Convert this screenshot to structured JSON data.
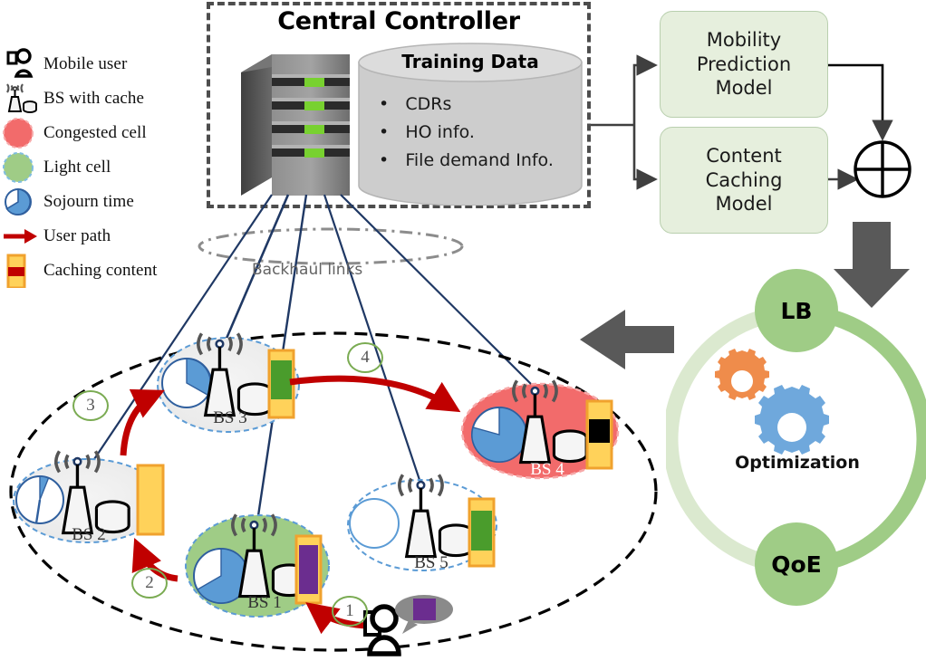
{
  "legend": {
    "items": [
      {
        "icon": "mobile-user-icon",
        "label": "Mobile user"
      },
      {
        "icon": "base-station-cache-icon",
        "label": "BS with cache"
      },
      {
        "icon": "congested-cell-icon",
        "label": "Congested cell"
      },
      {
        "icon": "light-cell-icon",
        "label": "Light cell"
      },
      {
        "icon": "sojourn-time-icon",
        "label": "Sojourn time"
      },
      {
        "icon": "user-path-arrow-icon",
        "label": "User path"
      },
      {
        "icon": "caching-content-icon",
        "label": "Caching content"
      }
    ]
  },
  "controller": {
    "title": "Central Controller",
    "server_icon": "server-rack-icon",
    "database": {
      "title": "Training Data",
      "bullets": [
        "CDRs",
        "HO info.",
        "File demand Info."
      ]
    }
  },
  "models": {
    "mobility": "Mobility Prediction Model",
    "mobility_lines": [
      "Mobility",
      "Prediction",
      "Model"
    ],
    "caching": "Content Caching Model",
    "caching_lines": [
      "Content",
      "Caching",
      "Model"
    ],
    "combiner_icon": "circled-plus-icon"
  },
  "optimization": {
    "top_label": "LB",
    "bottom_label": "QoE",
    "center_label": "Optimization",
    "gear_icons": [
      "gear-icon-orange",
      "gear-icon-blue"
    ]
  },
  "network": {
    "backhaul_label": "Backhaul links",
    "base_stations": [
      {
        "id": "bs1",
        "label": "BS 1",
        "cell_type": "light",
        "sojourn_fill_pct": 70,
        "cache_color": "#6b2d8f",
        "cache_fill_pct": 72
      },
      {
        "id": "bs2",
        "label": "BS 2",
        "cell_type": "normal",
        "sojourn_fill_pct": 8,
        "cache_color": "none",
        "cache_fill_pct": 0
      },
      {
        "id": "bs3",
        "label": "BS 3",
        "cell_type": "normal",
        "sojourn_fill_pct": 22,
        "cache_color": "#4a9c2c",
        "cache_fill_pct": 58
      },
      {
        "id": "bs4",
        "label": "BS 4",
        "cell_type": "congested",
        "sojourn_fill_pct": 72,
        "cache_color": "#000000",
        "cache_fill_pct": 32
      },
      {
        "id": "bs5",
        "label": "BS 5",
        "cell_type": "normal",
        "sojourn_fill_pct": 0,
        "cache_color": "#4a9c2c",
        "cache_fill_pct": 60
      }
    ],
    "steps": [
      {
        "number": "1"
      },
      {
        "number": "2"
      },
      {
        "number": "3"
      },
      {
        "number": "4"
      }
    ],
    "user_request_icon": "speech-bubble-icon",
    "user_icon": "mobile-user-icon"
  },
  "colors": {
    "congested_cell": "#f26b6b",
    "light_cell": "#9fcc86",
    "model_box": "#e6efdd",
    "accent_green": "#9fcc86",
    "user_path": "#c00000",
    "backhaul_link": "#1f3864",
    "cache_border": "#f0a22e",
    "cache_fill": "#ffd25a",
    "gear_orange": "#ef8c4b",
    "gear_blue": "#6fa8dc",
    "grey_arrow": "#595959"
  }
}
